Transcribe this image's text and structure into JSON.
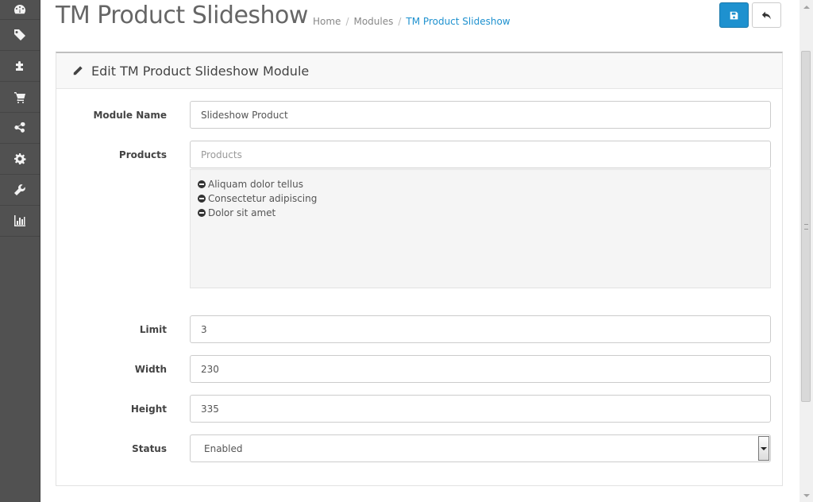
{
  "header": {
    "title": "TM Product Slideshow",
    "breadcrumb": [
      "Home",
      "Modules",
      "TM Product Slideshow"
    ]
  },
  "sidebar": {
    "icons": [
      "dashboard-icon",
      "tags-icon",
      "puzzle-icon",
      "shopping-cart-icon",
      "share-icon",
      "cog-icon",
      "wrench-icon",
      "bar-chart-icon"
    ]
  },
  "actions": {
    "save_icon": "floppy-disk-icon",
    "back_icon": "reply-icon"
  },
  "panel": {
    "title": "Edit TM Product Slideshow Module"
  },
  "form": {
    "module_name_label": "Module Name",
    "module_name_value": "Slideshow Product",
    "products_label": "Products",
    "products_placeholder": "Products",
    "products": [
      "Aliquam dolor tellus",
      "Consectetur adipiscing",
      "Dolor sit amet"
    ],
    "limit_label": "Limit",
    "limit_value": "3",
    "width_label": "Width",
    "width_value": "230",
    "height_label": "Height",
    "height_value": "335",
    "status_label": "Status",
    "status_value": "Enabled"
  },
  "colors": {
    "primary": "#1e91cf",
    "sidebar": "#515151"
  }
}
